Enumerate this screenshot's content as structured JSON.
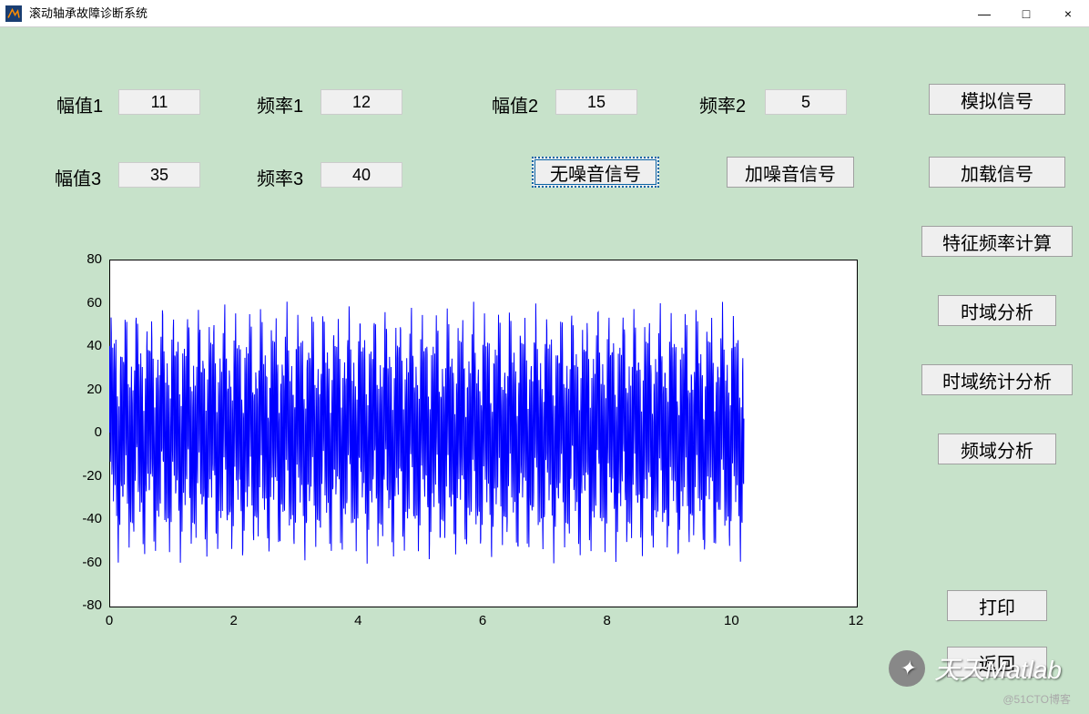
{
  "window": {
    "title": "滚动轴承故障诊断系统",
    "minimize": "—",
    "maximize": "□",
    "close": "×"
  },
  "inputs": {
    "amp1_label": "幅值1",
    "amp1_value": "11",
    "freq1_label": "频率1",
    "freq1_value": "12",
    "amp2_label": "幅值2",
    "amp2_value": "15",
    "freq2_label": "频率2",
    "freq2_value": "5",
    "amp3_label": "幅值3",
    "amp3_value": "35",
    "freq3_label": "频率3",
    "freq3_value": "40"
  },
  "buttons": {
    "simulate": "模拟信号",
    "load": "加载信号",
    "feature_freq": "特征频率计算",
    "time_analysis": "时域分析",
    "time_stats": "时域统计分析",
    "freq_analysis": "频域分析",
    "print": "打印",
    "back": "返回",
    "no_noise": "无噪音信号",
    "add_noise": "加噪音信号"
  },
  "chart_data": {
    "type": "line",
    "title": "",
    "xlabel": "",
    "ylabel": "",
    "x_range": [
      0,
      12
    ],
    "y_range": [
      -80,
      80
    ],
    "x_ticks": [
      0,
      2,
      4,
      6,
      8,
      10,
      12
    ],
    "y_ticks": [
      -80,
      -60,
      -40,
      -20,
      0,
      20,
      40,
      60,
      80
    ],
    "signal": {
      "components": [
        {
          "amplitude": 11,
          "frequency": 12
        },
        {
          "amplitude": 15,
          "frequency": 5
        },
        {
          "amplitude": 35,
          "frequency": 40
        }
      ],
      "x_data_extent": [
        0,
        10.2
      ],
      "approx_peak": 61,
      "approx_trough": -61,
      "color": "#0000ff"
    }
  },
  "watermark": {
    "label": "天天Matlab",
    "footer": "@51CTO博客"
  }
}
